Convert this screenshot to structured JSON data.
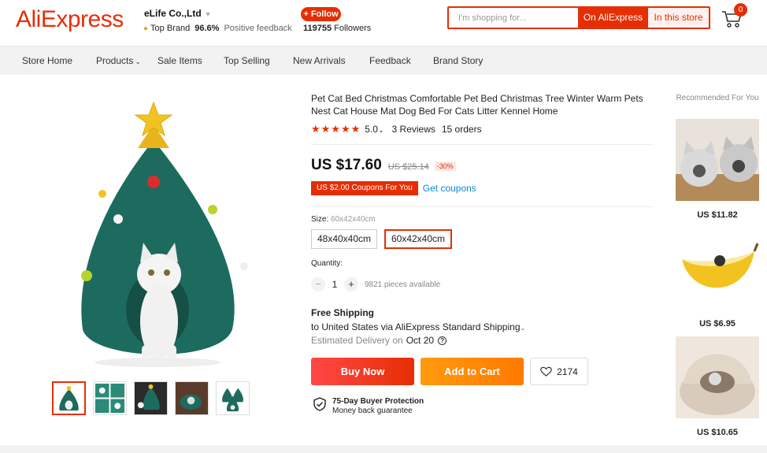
{
  "header": {
    "logo": "AliExpress",
    "store_name": "eLife Co.,Ltd",
    "store_badge": "Top Brand",
    "feedback_pct": "96.6%",
    "feedback_label": "Positive feedback",
    "follow_label": "+ Follow",
    "followers_count": "119755",
    "followers_label": "Followers",
    "search_placeholder": "I'm shopping for...",
    "search_ali_label": "On AliExpress",
    "search_store_label": "In this store",
    "cart_count": "0"
  },
  "nav": {
    "items": [
      "Store Home",
      "Products",
      "Sale Items",
      "Top Selling",
      "New Arrivals",
      "Feedback",
      "Brand Story"
    ]
  },
  "product": {
    "title": "Pet Cat Bed Christmas Comfortable Pet Bed Christmas Tree Winter Warm Pets Nest Cat House Mat Dog Bed For Cats Litter Kennel Home",
    "stars": "★★★★★",
    "rating": "5.0",
    "reviews": "3 Reviews",
    "orders": "15 orders",
    "price": "US $17.60",
    "old_price": "US $25.14",
    "discount": "-30%",
    "coupon": "US $2.00 Coupons For You",
    "get_coupons": "Get coupons",
    "size_label": "Size:",
    "size_selected": "60x42x40cm",
    "sizes": [
      "48x40x40cm",
      "60x42x40cm"
    ],
    "quantity_label": "Quantity:",
    "quantity": "1",
    "available": "9821 pieces available",
    "shipping_title": "Free Shipping",
    "shipping_line": "to United States via AliExpress Standard Shipping",
    "delivery_label": "Estimated Delivery on",
    "delivery_date": "Oct 20",
    "buy_now": "Buy Now",
    "add_to_cart": "Add to Cart",
    "wishlist_count": "2174",
    "protection_title": "75-Day Buyer Protection",
    "protection_sub": "Money back guarantee"
  },
  "recommended": {
    "title": "Recommended For You",
    "items": [
      {
        "price": "US $11.82"
      },
      {
        "price": "US $6.95"
      },
      {
        "price": "US $10.65"
      }
    ]
  },
  "colors": {
    "brand": "#e62e04",
    "buy_now": "#ff4747",
    "add_to_cart": "#ff9a0d",
    "link": "#0b8ad1"
  }
}
